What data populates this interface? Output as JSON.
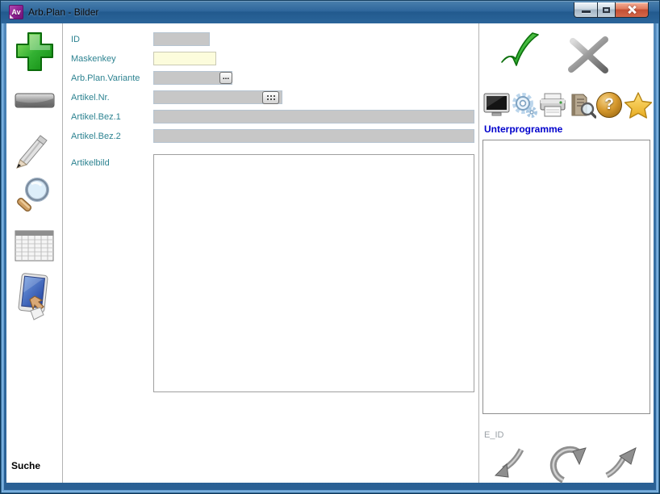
{
  "window": {
    "title": "Arb.Plan - Bilder",
    "app_icon_label": "Av"
  },
  "sidebar": {
    "search_label": "Suche"
  },
  "form": {
    "fields": {
      "id": {
        "label": "ID",
        "value": ""
      },
      "maskenkey": {
        "label": "Maskenkey",
        "value": ""
      },
      "variante": {
        "label": "Arb.Plan.Variante",
        "value": "",
        "button_label": "..."
      },
      "artikel_nr": {
        "label": "Artikel.Nr.",
        "value": ""
      },
      "bez1": {
        "label": "Artikel.Bez.1",
        "value": ""
      },
      "bez2": {
        "label": "Artikel.Bez.2",
        "value": ""
      },
      "artikelbild": {
        "label": "Artikelbild"
      }
    }
  },
  "right_panel": {
    "subprograms_label": "Unterprogramme",
    "eid_label": "E_ID",
    "help_glyph": "?"
  },
  "colors": {
    "titlebar_blue": "#2f679c",
    "frame_blue": "#3a74a8",
    "label_teal": "#2d8391",
    "subprogram_blue": "#0000cc",
    "ok_green": "#2fae2f",
    "field_gray": "#c7c7c7",
    "field_yellow": "#fcfcdc",
    "star_gold": "#f7c832",
    "close_red": "#c44f33"
  }
}
